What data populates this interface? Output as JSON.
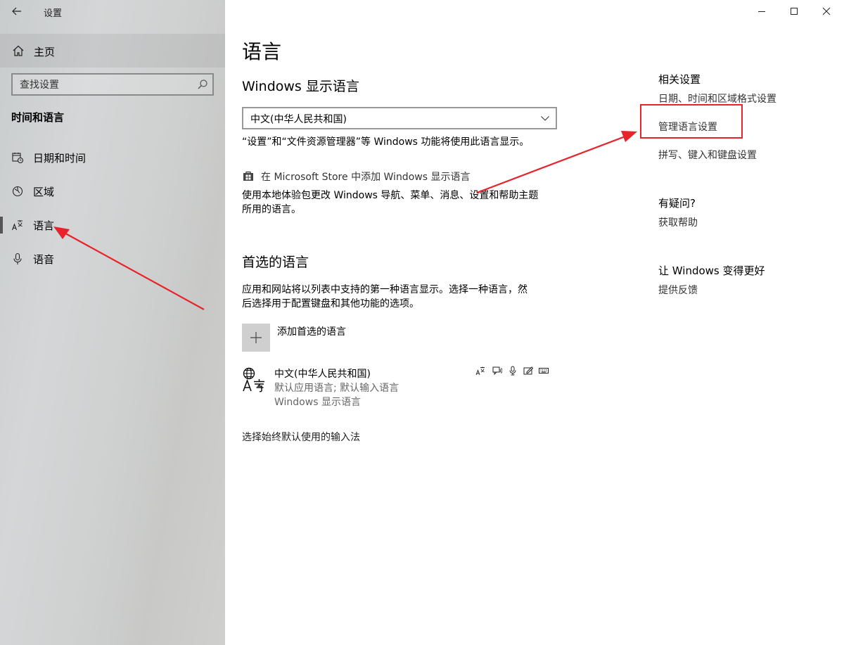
{
  "window": {
    "title": "设置"
  },
  "sidebar": {
    "home_label": "主页",
    "search_placeholder": "查找设置",
    "section_title": "时间和语言",
    "items": [
      {
        "label": "日期和时间",
        "icon": "date-time-icon"
      },
      {
        "label": "区域",
        "icon": "region-icon"
      },
      {
        "label": "语言",
        "icon": "language-icon",
        "active": true
      },
      {
        "label": "语音",
        "icon": "microphone-icon"
      }
    ]
  },
  "main": {
    "page_title": "语言",
    "display_language": {
      "heading": "Windows 显示语言",
      "selected": "中文(中华人民共和国)",
      "description": "“设置”和“文件资源管理器”等 Windows 功能将使用此语言显示。",
      "store_link": "在 Microsoft Store 中添加 Windows 显示语言",
      "store_description_line1": "使用本地体验包更改 Windows 导航、菜单、消息、设置和帮助主题",
      "store_description_line2": "所用的语言。"
    },
    "preferred": {
      "heading": "首选的语言",
      "description_line1": "应用和网站将以列表中支持的第一种语言显示。选择一种语言，然",
      "description_line2": "后选择用于配置键盘和其他功能的选项。",
      "add_label": "添加首选的语言",
      "languages": [
        {
          "name": "中文(中华人民共和国)",
          "sub1": "默认应用语言; 默认输入语言",
          "sub2": "Windows 显示语言"
        }
      ],
      "input_method_link": "选择始终默认使用的输入法"
    }
  },
  "related": {
    "heading": "相关设置",
    "links": [
      "日期、时间和区域格式设置",
      "管理语言设置",
      "拼写、键入和键盘设置"
    ],
    "help_heading": "有疑问?",
    "help_link": "获取帮助",
    "feedback_heading": "让 Windows 变得更好",
    "feedback_link": "提供反馈"
  },
  "colors": {
    "annotation": "#e8232b",
    "sidebar_bg": "#cfd1d1"
  }
}
